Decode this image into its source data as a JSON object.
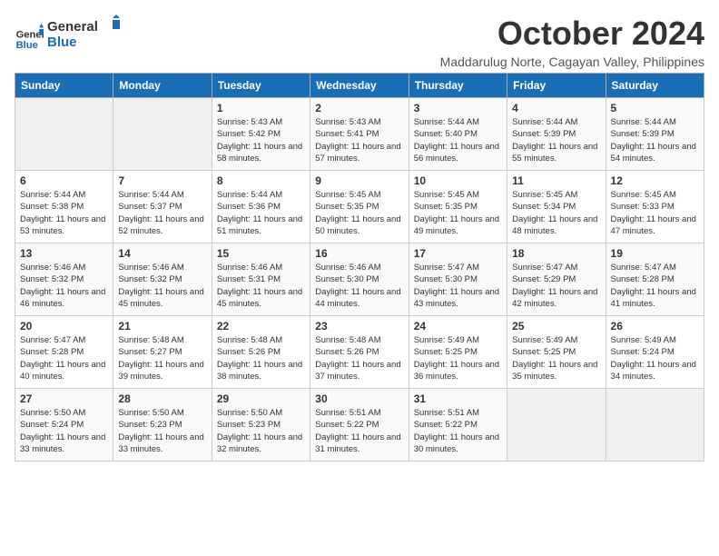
{
  "header": {
    "logo_line1": "General",
    "logo_line2": "Blue",
    "month_title": "October 2024",
    "subtitle": "Maddarulug Norte, Cagayan Valley, Philippines"
  },
  "weekdays": [
    "Sunday",
    "Monday",
    "Tuesday",
    "Wednesday",
    "Thursday",
    "Friday",
    "Saturday"
  ],
  "weeks": [
    [
      {
        "num": "",
        "info": ""
      },
      {
        "num": "",
        "info": ""
      },
      {
        "num": "1",
        "info": "Sunrise: 5:43 AM\nSunset: 5:42 PM\nDaylight: 11 hours and 58 minutes."
      },
      {
        "num": "2",
        "info": "Sunrise: 5:43 AM\nSunset: 5:41 PM\nDaylight: 11 hours and 57 minutes."
      },
      {
        "num": "3",
        "info": "Sunrise: 5:44 AM\nSunset: 5:40 PM\nDaylight: 11 hours and 56 minutes."
      },
      {
        "num": "4",
        "info": "Sunrise: 5:44 AM\nSunset: 5:39 PM\nDaylight: 11 hours and 55 minutes."
      },
      {
        "num": "5",
        "info": "Sunrise: 5:44 AM\nSunset: 5:39 PM\nDaylight: 11 hours and 54 minutes."
      }
    ],
    [
      {
        "num": "6",
        "info": "Sunrise: 5:44 AM\nSunset: 5:38 PM\nDaylight: 11 hours and 53 minutes."
      },
      {
        "num": "7",
        "info": "Sunrise: 5:44 AM\nSunset: 5:37 PM\nDaylight: 11 hours and 52 minutes."
      },
      {
        "num": "8",
        "info": "Sunrise: 5:44 AM\nSunset: 5:36 PM\nDaylight: 11 hours and 51 minutes."
      },
      {
        "num": "9",
        "info": "Sunrise: 5:45 AM\nSunset: 5:35 PM\nDaylight: 11 hours and 50 minutes."
      },
      {
        "num": "10",
        "info": "Sunrise: 5:45 AM\nSunset: 5:35 PM\nDaylight: 11 hours and 49 minutes."
      },
      {
        "num": "11",
        "info": "Sunrise: 5:45 AM\nSunset: 5:34 PM\nDaylight: 11 hours and 48 minutes."
      },
      {
        "num": "12",
        "info": "Sunrise: 5:45 AM\nSunset: 5:33 PM\nDaylight: 11 hours and 47 minutes."
      }
    ],
    [
      {
        "num": "13",
        "info": "Sunrise: 5:46 AM\nSunset: 5:32 PM\nDaylight: 11 hours and 46 minutes."
      },
      {
        "num": "14",
        "info": "Sunrise: 5:46 AM\nSunset: 5:32 PM\nDaylight: 11 hours and 45 minutes."
      },
      {
        "num": "15",
        "info": "Sunrise: 5:46 AM\nSunset: 5:31 PM\nDaylight: 11 hours and 45 minutes."
      },
      {
        "num": "16",
        "info": "Sunrise: 5:46 AM\nSunset: 5:30 PM\nDaylight: 11 hours and 44 minutes."
      },
      {
        "num": "17",
        "info": "Sunrise: 5:47 AM\nSunset: 5:30 PM\nDaylight: 11 hours and 43 minutes."
      },
      {
        "num": "18",
        "info": "Sunrise: 5:47 AM\nSunset: 5:29 PM\nDaylight: 11 hours and 42 minutes."
      },
      {
        "num": "19",
        "info": "Sunrise: 5:47 AM\nSunset: 5:28 PM\nDaylight: 11 hours and 41 minutes."
      }
    ],
    [
      {
        "num": "20",
        "info": "Sunrise: 5:47 AM\nSunset: 5:28 PM\nDaylight: 11 hours and 40 minutes."
      },
      {
        "num": "21",
        "info": "Sunrise: 5:48 AM\nSunset: 5:27 PM\nDaylight: 11 hours and 39 minutes."
      },
      {
        "num": "22",
        "info": "Sunrise: 5:48 AM\nSunset: 5:26 PM\nDaylight: 11 hours and 38 minutes."
      },
      {
        "num": "23",
        "info": "Sunrise: 5:48 AM\nSunset: 5:26 PM\nDaylight: 11 hours and 37 minutes."
      },
      {
        "num": "24",
        "info": "Sunrise: 5:49 AM\nSunset: 5:25 PM\nDaylight: 11 hours and 36 minutes."
      },
      {
        "num": "25",
        "info": "Sunrise: 5:49 AM\nSunset: 5:25 PM\nDaylight: 11 hours and 35 minutes."
      },
      {
        "num": "26",
        "info": "Sunrise: 5:49 AM\nSunset: 5:24 PM\nDaylight: 11 hours and 34 minutes."
      }
    ],
    [
      {
        "num": "27",
        "info": "Sunrise: 5:50 AM\nSunset: 5:24 PM\nDaylight: 11 hours and 33 minutes."
      },
      {
        "num": "28",
        "info": "Sunrise: 5:50 AM\nSunset: 5:23 PM\nDaylight: 11 hours and 33 minutes."
      },
      {
        "num": "29",
        "info": "Sunrise: 5:50 AM\nSunset: 5:23 PM\nDaylight: 11 hours and 32 minutes."
      },
      {
        "num": "30",
        "info": "Sunrise: 5:51 AM\nSunset: 5:22 PM\nDaylight: 11 hours and 31 minutes."
      },
      {
        "num": "31",
        "info": "Sunrise: 5:51 AM\nSunset: 5:22 PM\nDaylight: 11 hours and 30 minutes."
      },
      {
        "num": "",
        "info": ""
      },
      {
        "num": "",
        "info": ""
      }
    ]
  ]
}
